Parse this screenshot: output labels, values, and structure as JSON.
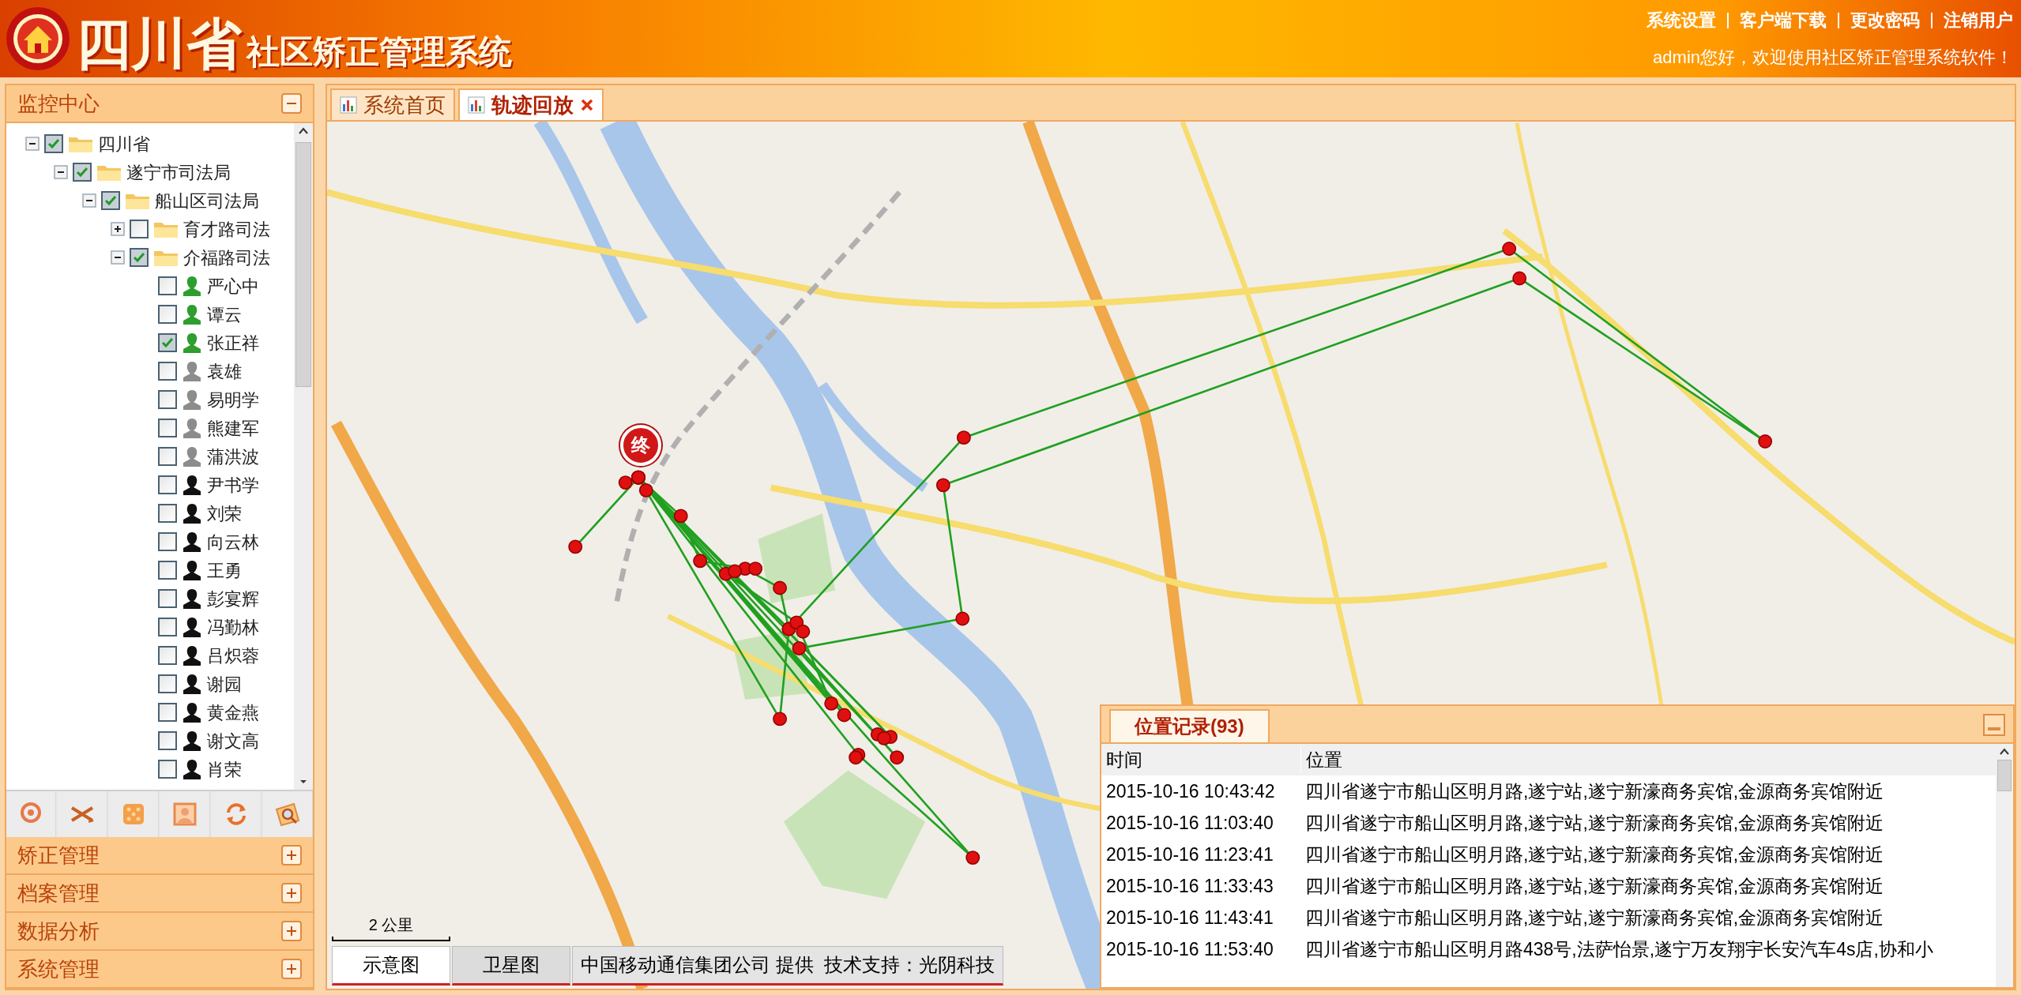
{
  "header": {
    "title_province": "四川省",
    "title_system": "社区矫正管理系统",
    "top_links": [
      "系统设置",
      "客户端下载",
      "更改密码",
      "注销用户"
    ],
    "welcome": "admin您好，欢迎使用社区矫正管理系统软件！"
  },
  "sidebar": {
    "sections": [
      {
        "title": "监控中心",
        "expanded": true
      },
      {
        "title": "矫正管理",
        "expanded": false
      },
      {
        "title": "档案管理",
        "expanded": false
      },
      {
        "title": "数据分析",
        "expanded": false
      },
      {
        "title": "系统管理",
        "expanded": false
      }
    ],
    "tree": [
      {
        "label": "四川省",
        "kind": "folder",
        "checked": true,
        "expanded": true,
        "children": [
          {
            "label": "遂宁市司法局",
            "kind": "folder",
            "checked": true,
            "expanded": true,
            "children": [
              {
                "label": "船山区司法局",
                "kind": "folder",
                "checked": true,
                "expanded": true,
                "children": [
                  {
                    "label": "育才路司法",
                    "kind": "folder",
                    "checked": false,
                    "expanded": false
                  },
                  {
                    "label": "介福路司法",
                    "kind": "folder",
                    "checked": true,
                    "expanded": true,
                    "children": [
                      {
                        "label": "严心中",
                        "kind": "person",
                        "checked": false,
                        "color": "#2e9e2e"
                      },
                      {
                        "label": "谭云",
                        "kind": "person",
                        "checked": false,
                        "color": "#2e9e2e"
                      },
                      {
                        "label": "张正祥",
                        "kind": "person",
                        "checked": true,
                        "color": "#2e9e2e"
                      },
                      {
                        "label": "袁雄",
                        "kind": "person",
                        "checked": false,
                        "color": "#8c8c8c"
                      },
                      {
                        "label": "易明学",
                        "kind": "person",
                        "checked": false,
                        "color": "#8c8c8c"
                      },
                      {
                        "label": "熊建军",
                        "kind": "person",
                        "checked": false,
                        "color": "#8c8c8c"
                      },
                      {
                        "label": "蒲洪波",
                        "kind": "person",
                        "checked": false,
                        "color": "#8c8c8c"
                      },
                      {
                        "label": "尹书学",
                        "kind": "person",
                        "checked": false,
                        "color": "#111111"
                      },
                      {
                        "label": "刘荣",
                        "kind": "person",
                        "checked": false,
                        "color": "#111111"
                      },
                      {
                        "label": "向云林",
                        "kind": "person",
                        "checked": false,
                        "color": "#111111"
                      },
                      {
                        "label": "王勇",
                        "kind": "person",
                        "checked": false,
                        "color": "#111111"
                      },
                      {
                        "label": "彭宴辉",
                        "kind": "person",
                        "checked": false,
                        "color": "#111111"
                      },
                      {
                        "label": "冯勤林",
                        "kind": "person",
                        "checked": false,
                        "color": "#111111"
                      },
                      {
                        "label": "吕炽蓉",
                        "kind": "person",
                        "checked": false,
                        "color": "#111111"
                      },
                      {
                        "label": "谢园",
                        "kind": "person",
                        "checked": false,
                        "color": "#111111"
                      },
                      {
                        "label": "黄金燕",
                        "kind": "person",
                        "checked": false,
                        "color": "#111111"
                      },
                      {
                        "label": "谢文高",
                        "kind": "person",
                        "checked": false,
                        "color": "#111111"
                      },
                      {
                        "label": "肖荣",
                        "kind": "person",
                        "checked": false,
                        "color": "#111111"
                      }
                    ]
                  }
                ]
              }
            ]
          }
        ]
      }
    ]
  },
  "tabs": [
    {
      "label": "系统首页",
      "selected": false,
      "closable": false
    },
    {
      "label": "轨迹回放",
      "selected": true,
      "closable": true
    }
  ],
  "map": {
    "end_marker": "终",
    "scale": "2 公里",
    "map_types": [
      {
        "label": "示意图",
        "selected": true
      },
      {
        "label": "卫星图",
        "selected": false
      }
    ],
    "attribution": "中国移动通信集团公司 提供  技术支持：光阴科技"
  },
  "records": {
    "tab": "位置记录(93)",
    "columns": [
      "时间",
      "位置"
    ],
    "rows": [
      {
        "time": "2015-10-16 10:43:42",
        "location": "四川省遂宁市船山区明月路,遂宁站,遂宁新濠商务宾馆,金源商务宾馆附近"
      },
      {
        "time": "2015-10-16 11:03:40",
        "location": "四川省遂宁市船山区明月路,遂宁站,遂宁新濠商务宾馆,金源商务宾馆附近"
      },
      {
        "time": "2015-10-16 11:23:41",
        "location": "四川省遂宁市船山区明月路,遂宁站,遂宁新濠商务宾馆,金源商务宾馆附近"
      },
      {
        "time": "2015-10-16 11:33:43",
        "location": "四川省遂宁市船山区明月路,遂宁站,遂宁新濠商务宾馆,金源商务宾馆附近"
      },
      {
        "time": "2015-10-16 11:43:41",
        "location": "四川省遂宁市船山区明月路,遂宁站,遂宁新濠商务宾馆,金源商务宾馆附近"
      },
      {
        "time": "2015-10-16 11:53:40",
        "location": "四川省遂宁市船山区明月路438号,法萨怡景,遂宁万友翔宇长安汽车4s店,协和小"
      }
    ]
  }
}
